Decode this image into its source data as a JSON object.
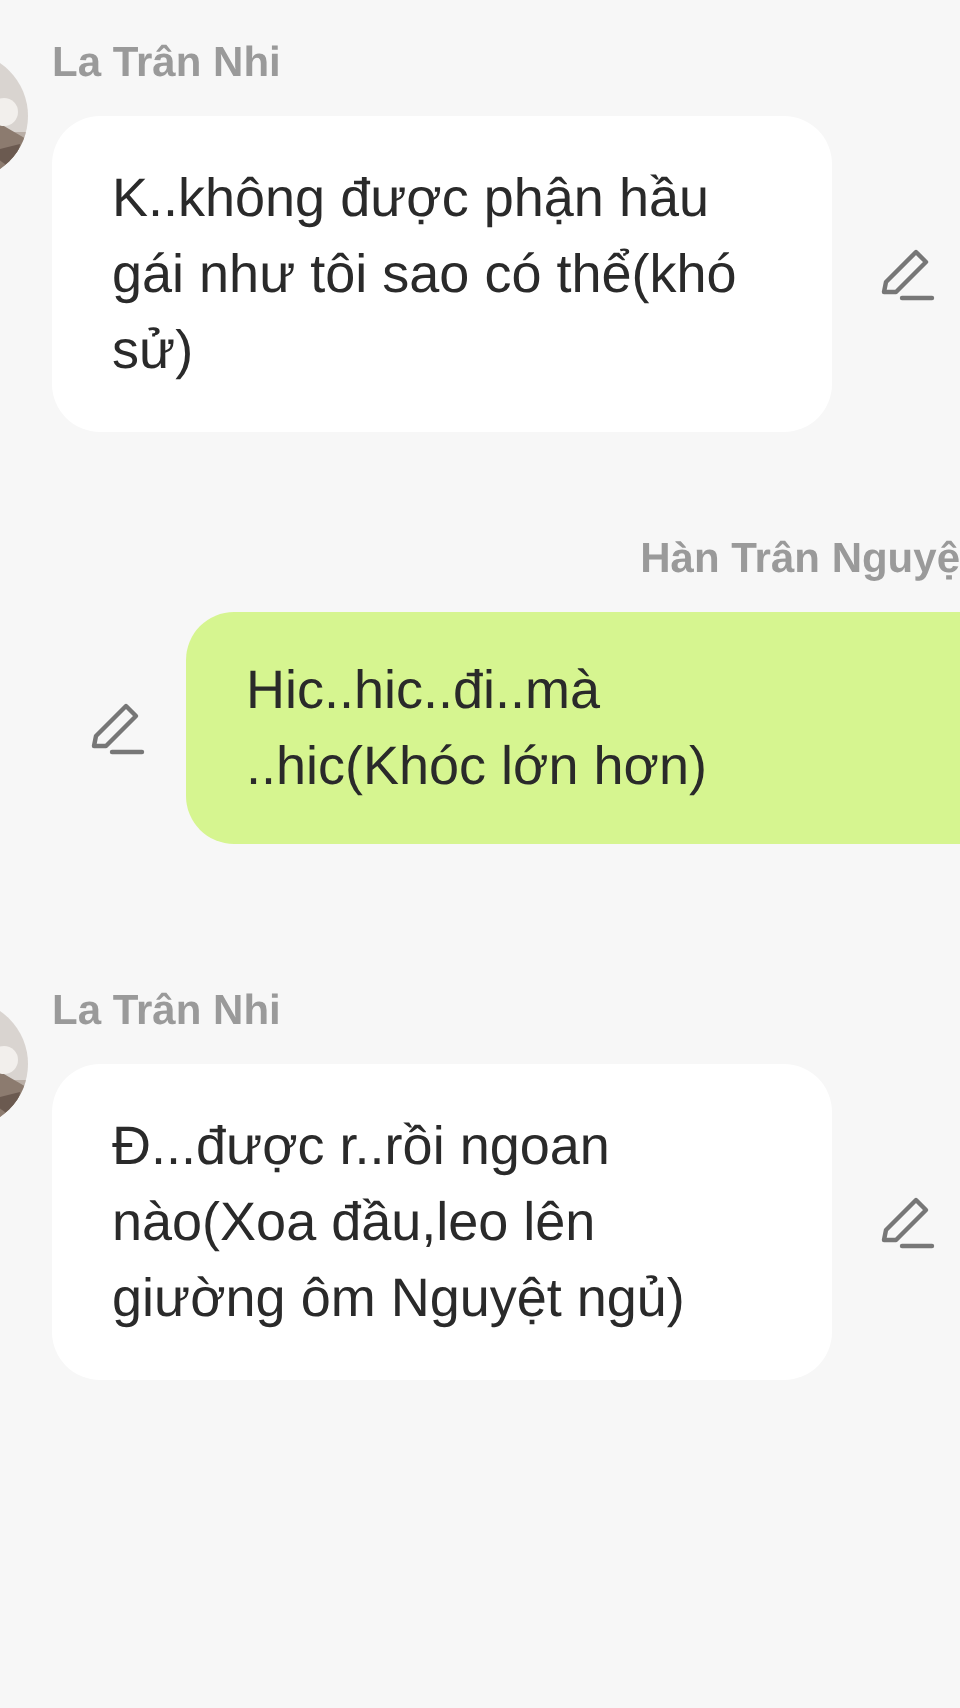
{
  "messages": [
    {
      "kind": "received",
      "sender": "La Trân Nhi",
      "text": "K..không được phận hầu gái như tôi sao có thể(khó sử)"
    },
    {
      "kind": "sent",
      "sender": "Hàn Trân Nguyệ",
      "text": "Hic..hic..đi..mà ..hic(Khóc lớn hơn)"
    },
    {
      "kind": "received",
      "sender": "La Trân Nhi",
      "text": "Đ...được r..rồi ngoan nào(Xoa đầu,leo lên giường ôm Nguyệt ngủ)"
    }
  ]
}
